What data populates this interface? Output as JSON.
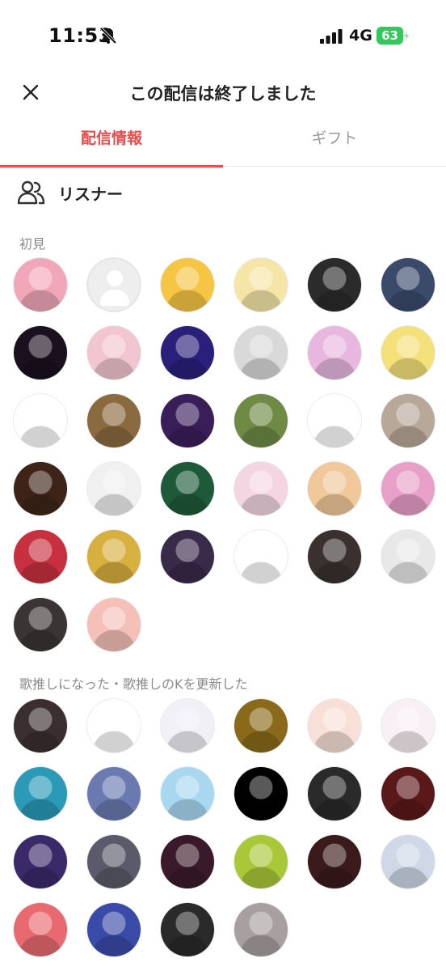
{
  "status_bar": {
    "time": "11:53",
    "network": "4G",
    "battery_level": "63",
    "icons": [
      "bell-slash-icon",
      "signal-bars-icon",
      "battery-charging-icon"
    ]
  },
  "header": {
    "title": "この配信は終了しました",
    "close_icon": "close-icon"
  },
  "tabs": [
    {
      "label": "配信情報",
      "active": true
    },
    {
      "label": "ギフト",
      "active": false
    }
  ],
  "listeners": {
    "label": "リスナー",
    "icon": "people-icon"
  },
  "sections": {
    "first_time": {
      "label": "初見",
      "avatars": [
        "#f2a7b8",
        "placeholder",
        "#f7c544",
        "#f5e6a8",
        "#2b2b2b",
        "#3a4a6b",
        "#1a1020",
        "#f2c6d0",
        "#2a1f7a",
        "#d9d9d9",
        "#e8b7e0",
        "#f5e17a",
        "#ffffff",
        "#8a6a3e",
        "#3a1e5a",
        "#6e8a45",
        "#ffffff",
        "#b8a898",
        "#3e2418",
        "#f0f0f0",
        "#1e5a3a",
        "#f3d6e2",
        "#f0c89a",
        "#e8a0c8",
        "#c83040",
        "#d8b040",
        "#3a2a4a",
        "#ffffff",
        "#3a3030",
        "#e8e8e8",
        "#3a3434",
        "#f4c0b8"
      ]
    },
    "oshi": {
      "label": "歌推しになった・歌推しのKを更新した",
      "avatars": [
        "#3a2e30",
        "#ffffff",
        "#f0f0f6",
        "#8a6a1a",
        "#f8e0d8",
        "#f8f0f4",
        "#2a9ab8",
        "#6a7ab0",
        "#a8d8f0",
        "#000000",
        "#2a2a2a",
        "#5a1818",
        "#3a2a6a",
        "#5a5a6a",
        "#3a1a2a",
        "#a8c838",
        "#3a1a1a",
        "#d0d8e8",
        "#e86a70",
        "#3a4aa8",
        "#2a2a2a",
        "#a8a0a0"
      ]
    }
  },
  "colors": {
    "accent": "#ef4b4b",
    "muted": "#8a8a8a",
    "battery": "#34c759"
  }
}
